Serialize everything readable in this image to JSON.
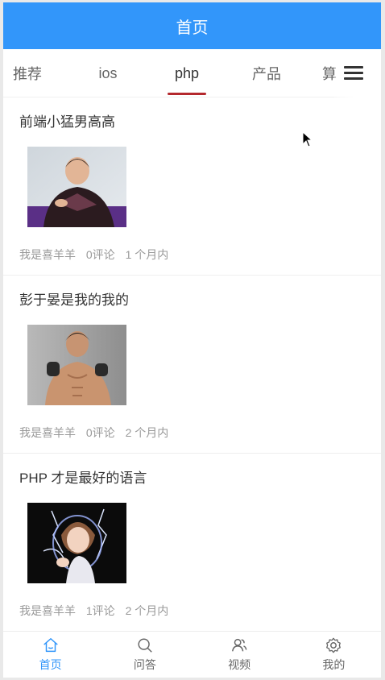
{
  "header": {
    "title": "首页"
  },
  "tabs": [
    {
      "label": "推荐"
    },
    {
      "label": "ios"
    },
    {
      "label": "php",
      "active": true
    },
    {
      "label": "产品"
    },
    {
      "label": "算"
    }
  ],
  "articles": [
    {
      "title": "前端小猛男高高",
      "author": "我是喜羊羊",
      "comments": "0评论",
      "time": "1 个月内"
    },
    {
      "title": "彭于晏是我的我的",
      "author": "我是喜羊羊",
      "comments": "0评论",
      "time": "2 个月内"
    },
    {
      "title": "PHP 才是最好的语言",
      "author": "我是喜羊羊",
      "comments": "1评论",
      "time": "2 个月内"
    }
  ],
  "bottom_nav": [
    {
      "label": "首页",
      "icon": "home-icon",
      "active": true
    },
    {
      "label": "问答",
      "icon": "search-icon"
    },
    {
      "label": "视频",
      "icon": "users-icon"
    },
    {
      "label": "我的",
      "icon": "gear-icon"
    }
  ],
  "colors": {
    "accent": "#3296fa",
    "tab_indicator": "#b4282d",
    "text": "#333333",
    "meta": "#999999"
  }
}
